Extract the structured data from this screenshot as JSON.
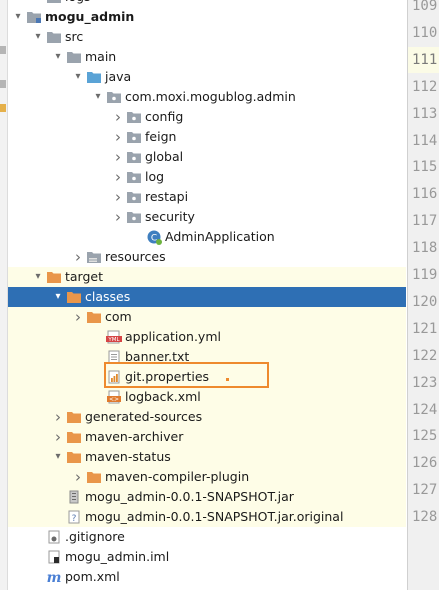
{
  "colors": {
    "selection": "#2e6fb4",
    "excluded_highlight": "#fefde7",
    "folder": "#9aa3ad",
    "java_folder": "#5aa3d6",
    "target_folder": "#e9964a",
    "callout": "#ee8a2e"
  },
  "tree": [
    {
      "label": "logs",
      "depth": 2,
      "arrow": "none",
      "icon": "folder-icon"
    },
    {
      "label": "mogu_admin",
      "depth": 1,
      "arrow": "down",
      "icon": "module-folder-icon",
      "bold": true
    },
    {
      "label": "src",
      "depth": 2,
      "arrow": "down",
      "icon": "folder-icon"
    },
    {
      "label": "main",
      "depth": 3,
      "arrow": "down",
      "icon": "folder-icon"
    },
    {
      "label": "java",
      "depth": 4,
      "arrow": "down",
      "icon": "source-folder-icon"
    },
    {
      "label": "com.moxi.mogublog.admin",
      "depth": 5,
      "arrow": "down",
      "icon": "package-icon"
    },
    {
      "label": "config",
      "depth": 6,
      "arrow": "right",
      "icon": "package-icon"
    },
    {
      "label": "feign",
      "depth": 6,
      "arrow": "right",
      "icon": "package-icon"
    },
    {
      "label": "global",
      "depth": 6,
      "arrow": "right",
      "icon": "package-icon"
    },
    {
      "label": "log",
      "depth": 6,
      "arrow": "right",
      "icon": "package-icon"
    },
    {
      "label": "restapi",
      "depth": 6,
      "arrow": "right",
      "icon": "package-icon"
    },
    {
      "label": "security",
      "depth": 6,
      "arrow": "right",
      "icon": "package-icon"
    },
    {
      "label": "AdminApplication",
      "depth": 7,
      "arrow": "none",
      "icon": "spring-class-icon"
    },
    {
      "label": "resources",
      "depth": 4,
      "arrow": "right",
      "icon": "resources-folder-icon"
    },
    {
      "label": "target",
      "depth": 2,
      "arrow": "down",
      "icon": "excluded-folder-icon",
      "hl": true
    },
    {
      "label": "classes",
      "depth": 3,
      "arrow": "down",
      "icon": "excluded-folder-icon",
      "sel": true
    },
    {
      "label": "com",
      "depth": 4,
      "arrow": "right",
      "icon": "excluded-folder-icon",
      "hl": true
    },
    {
      "label": "application.yml",
      "depth": 5,
      "arrow": "none",
      "icon": "yml-file-icon",
      "hl": true
    },
    {
      "label": "banner.txt",
      "depth": 5,
      "arrow": "none",
      "icon": "text-file-icon",
      "hl": true
    },
    {
      "label": "git.properties",
      "depth": 5,
      "arrow": "none",
      "icon": "properties-file-icon",
      "hl": true
    },
    {
      "label": "logback.xml",
      "depth": 5,
      "arrow": "none",
      "icon": "xml-file-icon",
      "hl": true
    },
    {
      "label": "generated-sources",
      "depth": 3,
      "arrow": "right",
      "icon": "excluded-folder-icon",
      "hl": true
    },
    {
      "label": "maven-archiver",
      "depth": 3,
      "arrow": "right",
      "icon": "excluded-folder-icon",
      "hl": true
    },
    {
      "label": "maven-status",
      "depth": 3,
      "arrow": "down",
      "icon": "excluded-folder-icon",
      "hl": true
    },
    {
      "label": "maven-compiler-plugin",
      "depth": 4,
      "arrow": "right",
      "icon": "excluded-folder-icon",
      "hl": true
    },
    {
      "label": "mogu_admin-0.0.1-SNAPSHOT.jar",
      "depth": 3,
      "arrow": "none",
      "icon": "jar-file-icon",
      "hl": true
    },
    {
      "label": "mogu_admin-0.0.1-SNAPSHOT.jar.original",
      "depth": 3,
      "arrow": "none",
      "icon": "unknown-file-icon",
      "hl": true
    },
    {
      "label": ".gitignore",
      "depth": 2,
      "arrow": "none",
      "icon": "gitignore-file-icon"
    },
    {
      "label": "mogu_admin.iml",
      "depth": 2,
      "arrow": "none",
      "icon": "iml-file-icon"
    },
    {
      "label": "pom.xml",
      "depth": 2,
      "arrow": "none",
      "icon": "maven-pom-icon"
    }
  ],
  "gutter": {
    "lines": [
      "109",
      "110",
      "111",
      "112",
      "113",
      "114",
      "115",
      "116",
      "117",
      "118",
      "119",
      "120",
      "121",
      "122",
      "123",
      "124",
      "125",
      "126",
      "127",
      "128"
    ],
    "current_line": "111"
  }
}
